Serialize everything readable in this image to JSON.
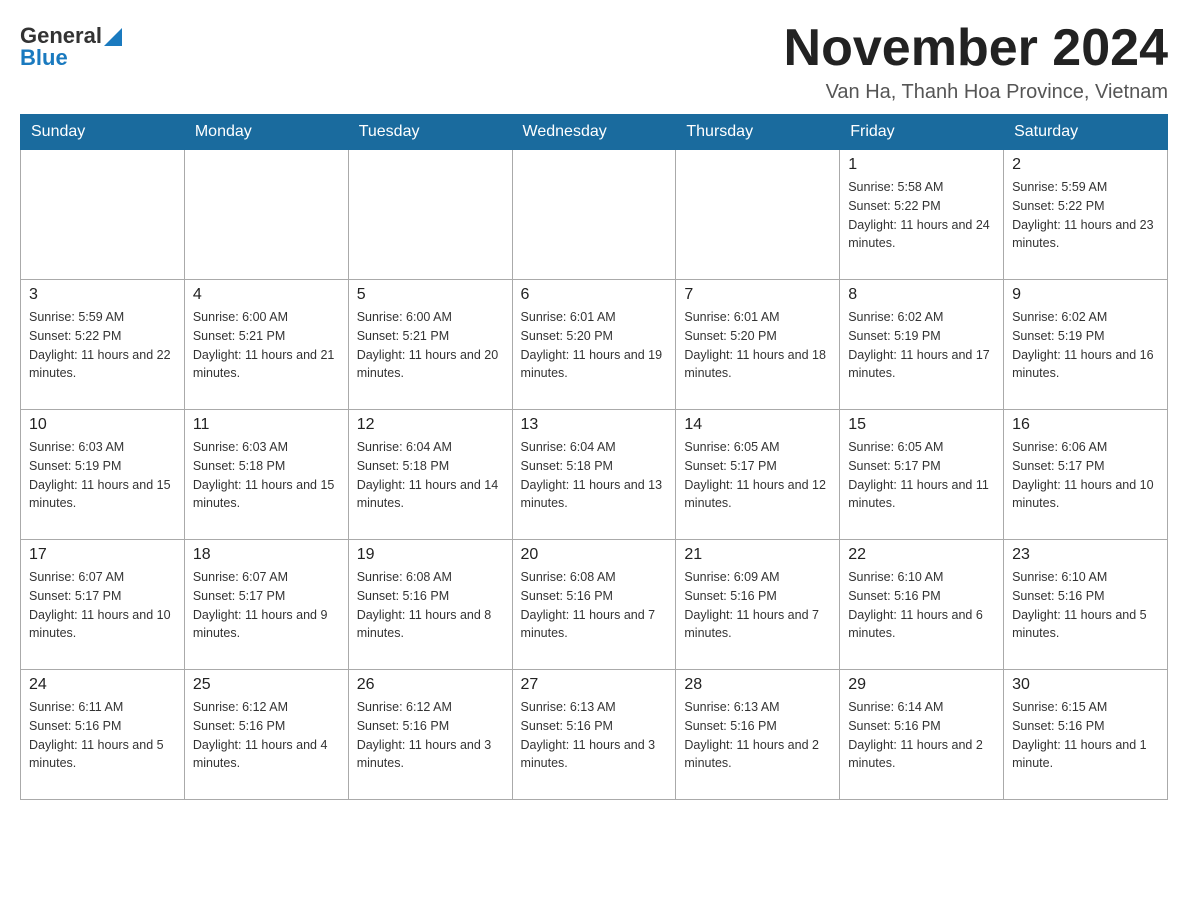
{
  "header": {
    "logo": {
      "general": "General",
      "blue": "Blue",
      "triangle": "▶"
    },
    "title": "November 2024",
    "location": "Van Ha, Thanh Hoa Province, Vietnam"
  },
  "weekdays": [
    "Sunday",
    "Monday",
    "Tuesday",
    "Wednesday",
    "Thursday",
    "Friday",
    "Saturday"
  ],
  "weeks": [
    [
      {
        "day": "",
        "info": ""
      },
      {
        "day": "",
        "info": ""
      },
      {
        "day": "",
        "info": ""
      },
      {
        "day": "",
        "info": ""
      },
      {
        "day": "",
        "info": ""
      },
      {
        "day": "1",
        "info": "Sunrise: 5:58 AM\nSunset: 5:22 PM\nDaylight: 11 hours and 24 minutes."
      },
      {
        "day": "2",
        "info": "Sunrise: 5:59 AM\nSunset: 5:22 PM\nDaylight: 11 hours and 23 minutes."
      }
    ],
    [
      {
        "day": "3",
        "info": "Sunrise: 5:59 AM\nSunset: 5:22 PM\nDaylight: 11 hours and 22 minutes."
      },
      {
        "day": "4",
        "info": "Sunrise: 6:00 AM\nSunset: 5:21 PM\nDaylight: 11 hours and 21 minutes."
      },
      {
        "day": "5",
        "info": "Sunrise: 6:00 AM\nSunset: 5:21 PM\nDaylight: 11 hours and 20 minutes."
      },
      {
        "day": "6",
        "info": "Sunrise: 6:01 AM\nSunset: 5:20 PM\nDaylight: 11 hours and 19 minutes."
      },
      {
        "day": "7",
        "info": "Sunrise: 6:01 AM\nSunset: 5:20 PM\nDaylight: 11 hours and 18 minutes."
      },
      {
        "day": "8",
        "info": "Sunrise: 6:02 AM\nSunset: 5:19 PM\nDaylight: 11 hours and 17 minutes."
      },
      {
        "day": "9",
        "info": "Sunrise: 6:02 AM\nSunset: 5:19 PM\nDaylight: 11 hours and 16 minutes."
      }
    ],
    [
      {
        "day": "10",
        "info": "Sunrise: 6:03 AM\nSunset: 5:19 PM\nDaylight: 11 hours and 15 minutes."
      },
      {
        "day": "11",
        "info": "Sunrise: 6:03 AM\nSunset: 5:18 PM\nDaylight: 11 hours and 15 minutes."
      },
      {
        "day": "12",
        "info": "Sunrise: 6:04 AM\nSunset: 5:18 PM\nDaylight: 11 hours and 14 minutes."
      },
      {
        "day": "13",
        "info": "Sunrise: 6:04 AM\nSunset: 5:18 PM\nDaylight: 11 hours and 13 minutes."
      },
      {
        "day": "14",
        "info": "Sunrise: 6:05 AM\nSunset: 5:17 PM\nDaylight: 11 hours and 12 minutes."
      },
      {
        "day": "15",
        "info": "Sunrise: 6:05 AM\nSunset: 5:17 PM\nDaylight: 11 hours and 11 minutes."
      },
      {
        "day": "16",
        "info": "Sunrise: 6:06 AM\nSunset: 5:17 PM\nDaylight: 11 hours and 10 minutes."
      }
    ],
    [
      {
        "day": "17",
        "info": "Sunrise: 6:07 AM\nSunset: 5:17 PM\nDaylight: 11 hours and 10 minutes."
      },
      {
        "day": "18",
        "info": "Sunrise: 6:07 AM\nSunset: 5:17 PM\nDaylight: 11 hours and 9 minutes."
      },
      {
        "day": "19",
        "info": "Sunrise: 6:08 AM\nSunset: 5:16 PM\nDaylight: 11 hours and 8 minutes."
      },
      {
        "day": "20",
        "info": "Sunrise: 6:08 AM\nSunset: 5:16 PM\nDaylight: 11 hours and 7 minutes."
      },
      {
        "day": "21",
        "info": "Sunrise: 6:09 AM\nSunset: 5:16 PM\nDaylight: 11 hours and 7 minutes."
      },
      {
        "day": "22",
        "info": "Sunrise: 6:10 AM\nSunset: 5:16 PM\nDaylight: 11 hours and 6 minutes."
      },
      {
        "day": "23",
        "info": "Sunrise: 6:10 AM\nSunset: 5:16 PM\nDaylight: 11 hours and 5 minutes."
      }
    ],
    [
      {
        "day": "24",
        "info": "Sunrise: 6:11 AM\nSunset: 5:16 PM\nDaylight: 11 hours and 5 minutes."
      },
      {
        "day": "25",
        "info": "Sunrise: 6:12 AM\nSunset: 5:16 PM\nDaylight: 11 hours and 4 minutes."
      },
      {
        "day": "26",
        "info": "Sunrise: 6:12 AM\nSunset: 5:16 PM\nDaylight: 11 hours and 3 minutes."
      },
      {
        "day": "27",
        "info": "Sunrise: 6:13 AM\nSunset: 5:16 PM\nDaylight: 11 hours and 3 minutes."
      },
      {
        "day": "28",
        "info": "Sunrise: 6:13 AM\nSunset: 5:16 PM\nDaylight: 11 hours and 2 minutes."
      },
      {
        "day": "29",
        "info": "Sunrise: 6:14 AM\nSunset: 5:16 PM\nDaylight: 11 hours and 2 minutes."
      },
      {
        "day": "30",
        "info": "Sunrise: 6:15 AM\nSunset: 5:16 PM\nDaylight: 11 hours and 1 minute."
      }
    ]
  ]
}
